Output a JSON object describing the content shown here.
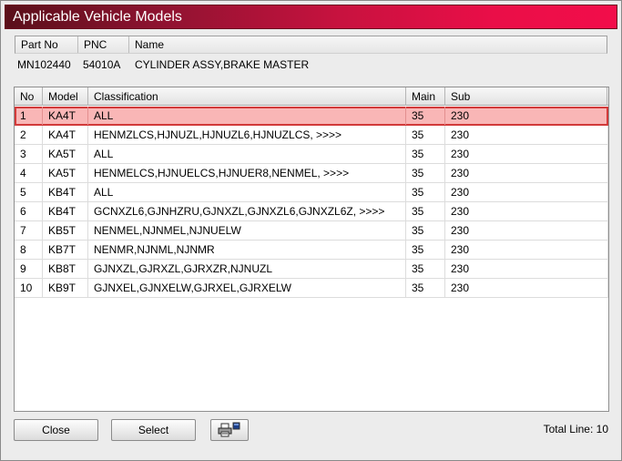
{
  "window": {
    "title": "Applicable Vehicle Models"
  },
  "part_info": {
    "headers": [
      "Part No",
      "PNC",
      "Name"
    ],
    "values": [
      "MN102440",
      "54010A",
      "CYLINDER ASSY,BRAKE MASTER"
    ]
  },
  "table": {
    "columns": [
      "No",
      "Model",
      "Classification",
      "Main",
      "Sub"
    ],
    "rows": [
      [
        "1",
        "KA4T",
        "ALL",
        "35",
        "230"
      ],
      [
        "2",
        "KA4T",
        "HENMZLCS,HJNUZL,HJNUZL6,HJNUZLCS,  >>>>",
        "35",
        "230"
      ],
      [
        "3",
        "KA5T",
        "ALL",
        "35",
        "230"
      ],
      [
        "4",
        "KA5T",
        "HENMELCS,HJNUELCS,HJNUER8,NENMEL,  >>>>",
        "35",
        "230"
      ],
      [
        "5",
        "KB4T",
        "ALL",
        "35",
        "230"
      ],
      [
        "6",
        "KB4T",
        "GCNXZL6,GJNHZRU,GJNXZL,GJNXZL6,GJNXZL6Z,  >>>>",
        "35",
        "230"
      ],
      [
        "7",
        "KB5T",
        "NENMEL,NJNMEL,NJNUELW",
        "35",
        "230"
      ],
      [
        "8",
        "KB7T",
        "NENMR,NJNML,NJNMR",
        "35",
        "230"
      ],
      [
        "9",
        "KB8T",
        "GJNXZL,GJRXZL,GJRXZR,NJNUZL",
        "35",
        "230"
      ],
      [
        "10",
        "KB9T",
        "GJNXEL,GJNXELW,GJRXEL,GJRXELW",
        "35",
        "230"
      ]
    ],
    "selected_row": 1
  },
  "buttons": {
    "close": "Close",
    "select": "Select",
    "print_icon": "printer-icon"
  },
  "footer": {
    "total_line": "Total Line: 10"
  }
}
